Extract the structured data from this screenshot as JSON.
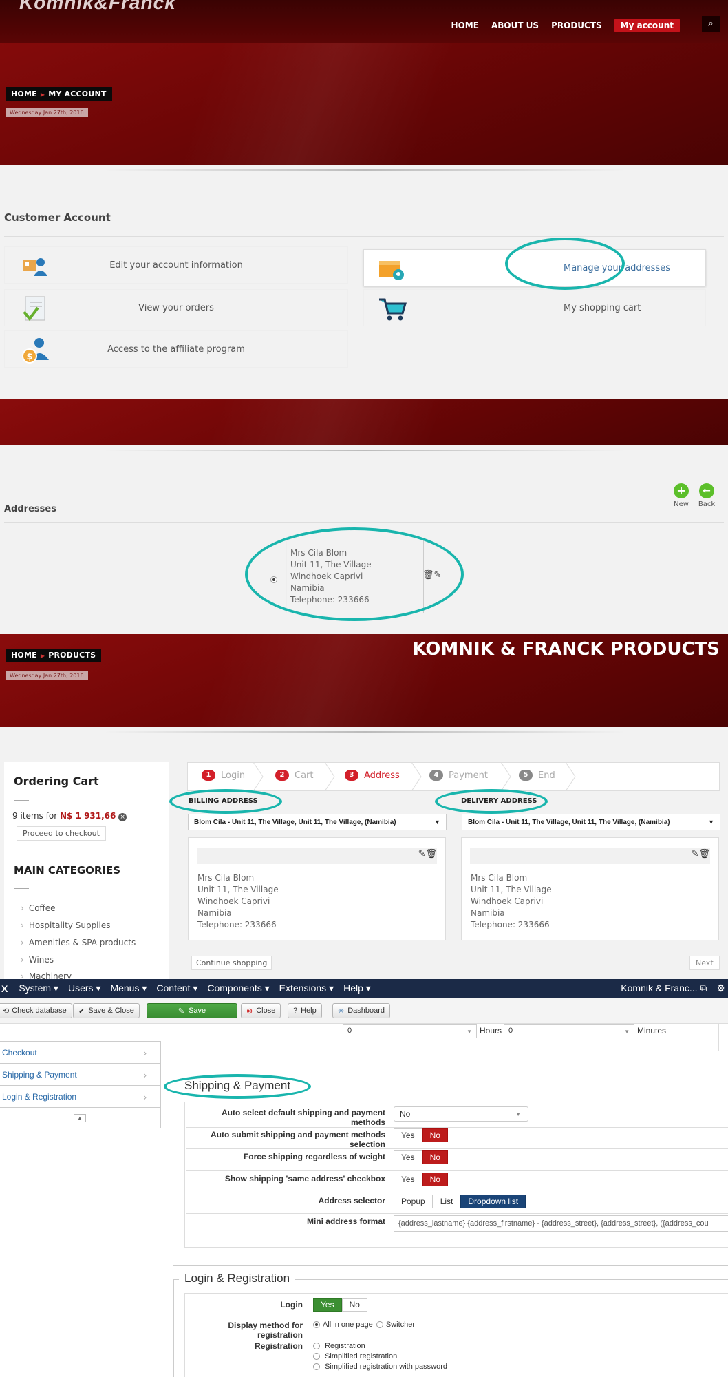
{
  "site": {
    "logo": "Komnik&Franck",
    "nav": {
      "home": "HOME",
      "about": "ABOUT US",
      "products": "PRODUCTS",
      "account": "My account"
    }
  },
  "hero1": {
    "crumb_home": "HOME",
    "crumb_current": "MY ACCOUNT",
    "date": "Wednesday Jan 27th, 2016"
  },
  "account": {
    "title": "Customer Account",
    "items": [
      {
        "label": "Edit your account information",
        "icon": "id-card-icon"
      },
      {
        "label": "Manage your addresses",
        "icon": "map-pin-box-icon"
      },
      {
        "label": "View your orders",
        "icon": "orders-checklist-icon"
      },
      {
        "label": "My shopping cart",
        "icon": "shopping-cart-icon"
      },
      {
        "label": "Access to the affiliate program",
        "icon": "affiliate-money-icon"
      }
    ]
  },
  "addresses": {
    "title": "Addresses",
    "new_label": "New",
    "back_label": "Back",
    "entry": [
      "Mrs Cila Blom",
      "Unit 11, The Village",
      "Windhoek Caprivi",
      "Namibia",
      "Telephone: 233666"
    ]
  },
  "hero2": {
    "crumb_home": "HOME",
    "crumb_current": "PRODUCTS",
    "date": "Wednesday Jan 27th, 2016",
    "headline": "KOMNIK & FRANCK PRODUCTS"
  },
  "cart": {
    "title": "Ordering Cart",
    "summary_prefix": "9 items for",
    "total": "N$ 1 931,66",
    "checkout": "Proceed to checkout",
    "categories_title": "MAIN CATEGORIES",
    "categories": [
      "Coffee",
      "Hospitality Supplies",
      "Amenities & SPA products",
      "Wines",
      "Machinery"
    ]
  },
  "checkout": {
    "steps": [
      {
        "n": "1",
        "label": "Login"
      },
      {
        "n": "2",
        "label": "Cart"
      },
      {
        "n": "3",
        "label": "Address"
      },
      {
        "n": "4",
        "label": "Payment"
      },
      {
        "n": "5",
        "label": "End"
      }
    ],
    "billing_title": "BILLING ADDRESS",
    "delivery_title": "DELIVERY ADDRESS",
    "billing_select": "Blom Cila - Unit 11, The Village, Unit 11, The Village, (Namibia)",
    "delivery_select": "Blom Cila - Unit 11, The Village, Unit 11, The Village, (Namibia)",
    "address_text": "Mrs Cila Blom\nUnit 11, The Village\nWindhoek Caprivi\nNamibia\nTelephone: 233666",
    "continue": "Continue shopping",
    "next": "Next"
  },
  "admin": {
    "menu": [
      "System",
      "Users",
      "Menus",
      "Content",
      "Components",
      "Extensions",
      "Help"
    ],
    "site_name": "Komnik & Franc...",
    "toolbar": {
      "check_db": "Check database",
      "save_close": "Save & Close",
      "save": "Save",
      "close": "Close",
      "help": "Help",
      "dashboard": "Dashboard"
    },
    "sidebar": [
      "Checkout",
      "Shipping & Payment",
      "Login & Registration"
    ],
    "time": {
      "hours_value": "0",
      "hours_label": "Hours",
      "minutes_value": "0",
      "minutes_label": "Minutes"
    },
    "shipping": {
      "legend": "Shipping & Payment",
      "auto_select_label": "Auto select default shipping and payment methods",
      "auto_select_value": "No",
      "auto_submit_label": "Auto submit shipping and payment methods selection",
      "force_label": "Force shipping regardless of weight",
      "same_addr_label": "Show shipping 'same address' checkbox",
      "yes": "Yes",
      "no": "No",
      "selector_label": "Address selector",
      "selector_options": [
        "Popup",
        "List",
        "Dropdown list"
      ],
      "mini_label": "Mini address format",
      "mini_value": "{address_lastname} {address_firstname} - {address_street}, {address_street}, ({address_cou"
    },
    "login": {
      "legend": "Login & Registration",
      "login_label": "Login",
      "display_label": "Display method for registration",
      "display_options": [
        "All in one page",
        "Switcher"
      ],
      "registration_label": "Registration",
      "registration_options": [
        "Registration",
        "Simplified registration",
        "Simplified registration with password"
      ]
    }
  },
  "colors": {
    "brand_red": "#7a0808",
    "accent_teal": "#19b5ad",
    "joomla_navy": "#1b2a47"
  }
}
